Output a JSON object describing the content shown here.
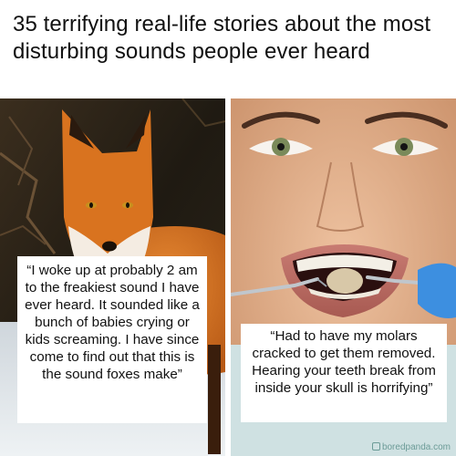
{
  "headline": "35 terrifying real-life stories about the most disturbing sounds people ever heard",
  "stories": [
    {
      "image": "fox-photo",
      "quote": "“I woke up at probably 2 am to the freakiest sound I have ever heard. It sounded like a bunch of babies crying or kids screaming. I have since come to find out that this is the sound foxes make”"
    },
    {
      "image": "dental-patient-photo",
      "quote": "“Had to have my molars cracked to get them removed. Hearing your teeth break from inside your skull is horrifying”"
    }
  ],
  "watermark": "boredpanda.com",
  "colors": {
    "fox_orange": "#d9731f",
    "forest_dark": "#2a2418",
    "skin_tone": "#e0b08c",
    "glove_blue": "#3d8fe0"
  }
}
